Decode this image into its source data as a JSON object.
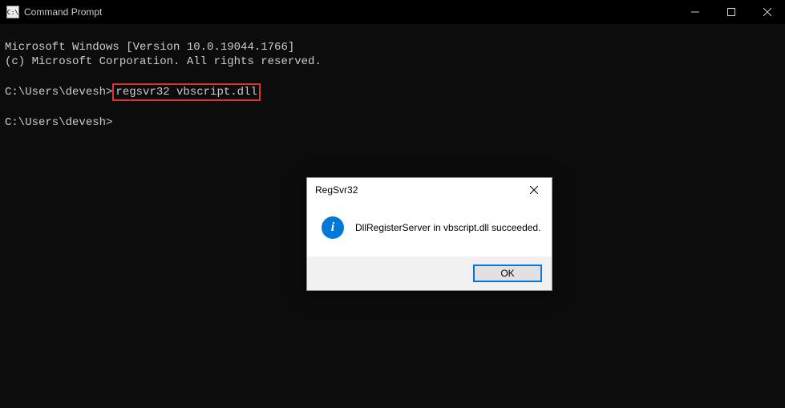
{
  "window": {
    "title": "Command Prompt",
    "icon_glyph": "C:\\"
  },
  "terminal": {
    "line1": "Microsoft Windows [Version 10.0.19044.1766]",
    "line2": "(c) Microsoft Corporation. All rights reserved.",
    "prompt1_prefix": "C:\\Users\\devesh>",
    "prompt1_command": "regsvr32 vbscript.dll",
    "prompt2": "C:\\Users\\devesh>"
  },
  "dialog": {
    "title": "RegSvr32",
    "message": "DllRegisterServer in vbscript.dll succeeded.",
    "ok_label": "OK",
    "info_glyph": "i"
  }
}
